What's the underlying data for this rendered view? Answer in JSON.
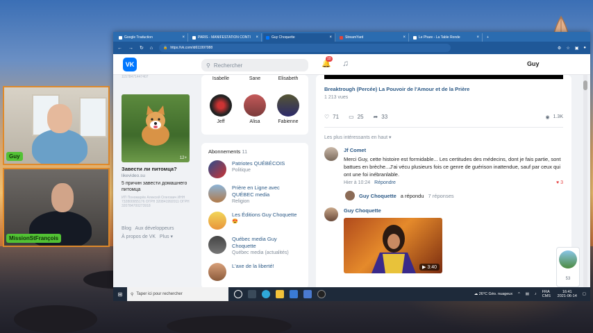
{
  "browser": {
    "tabs": [
      {
        "label": "Google Traduction"
      },
      {
        "label": "PARIS - MANIFESTATION CONTI"
      },
      {
        "label": "Guy Choquette",
        "active": true
      },
      {
        "label": "StreamYard"
      },
      {
        "label": "Le Phare - La Table Ronde"
      }
    ],
    "url": "https://vk.com/id611997088"
  },
  "vk": {
    "search_placeholder": "Rechercher",
    "notification_count": "10",
    "username": "Guy",
    "friends": [
      {
        "name": "Isabelle"
      },
      {
        "name": "Sane"
      },
      {
        "name": "Elisabeth"
      },
      {
        "name": "Jeff"
      },
      {
        "name": "Alisa"
      },
      {
        "name": "Fabienne"
      }
    ],
    "top_number": "11578471447407",
    "ad": {
      "duration": "12+",
      "title": "Завести ли питомца?",
      "site": "likevideo.su",
      "desc": "5 причин завести домашнего питомца",
      "small": "ИП Пономарёв Алексей Олегович ИНН 732800955176 ОГРН 320841992011 ОГРН 320784700273918"
    },
    "footer": {
      "blog": "Blog",
      "dev": "Aux développeurs",
      "about": "À propos de VK",
      "more": "Plus"
    },
    "subscriptions": {
      "title": "Abonnements",
      "count": "11",
      "items": [
        {
          "name": "Patriotes QUÉBÉCOIS",
          "category": "Politique"
        },
        {
          "name": "Prière en Ligne avec QUÉBEC media",
          "category": "Religion"
        },
        {
          "name": "Les Éditions Guy Choquette",
          "category": "😍"
        },
        {
          "name": "Québec media Guy Choquette",
          "category": "Québec media (actualités)"
        },
        {
          "name": "L'axe de la liberté!",
          "category": ""
        }
      ]
    },
    "post": {
      "title": "Breaktrough (Percée) La Pouvoir de l'Amour et de la Prière",
      "views": "1 213 vues",
      "likes": "71",
      "comments": "25",
      "shares": "33",
      "view_count": "1.3K",
      "sort": "Les plus intéressants en haut"
    },
    "comment1": {
      "author": "Jf Comet",
      "text": "Merci Guy, cette histoire est formidable... Les certitudes des médecins, dont je fais partie, sont battues en brèche...J'ai vécu plusieurs fois ce genre de guérison inattendue, sauf par ceux qui ont une foi inébranlable.",
      "time": "Hier à 10:24",
      "reply": "Répondre",
      "likes": "3"
    },
    "replied": {
      "author": "Guy Choquette",
      "action": "a répondu",
      "count": "7 réponses"
    },
    "comment2": {
      "author": "Guy Choquette",
      "video_duration": "3:40"
    },
    "chat_count": "53"
  },
  "cams": {
    "cam1_label": "Guy",
    "cam2_label": "MissionStFrançois"
  },
  "taskbar": {
    "search_placeholder": "Taper ici pour rechercher",
    "weather": "26°C Géo. nuageux",
    "lang": "FRA CMS",
    "time": "16:41",
    "date": "2021-06-14"
  }
}
